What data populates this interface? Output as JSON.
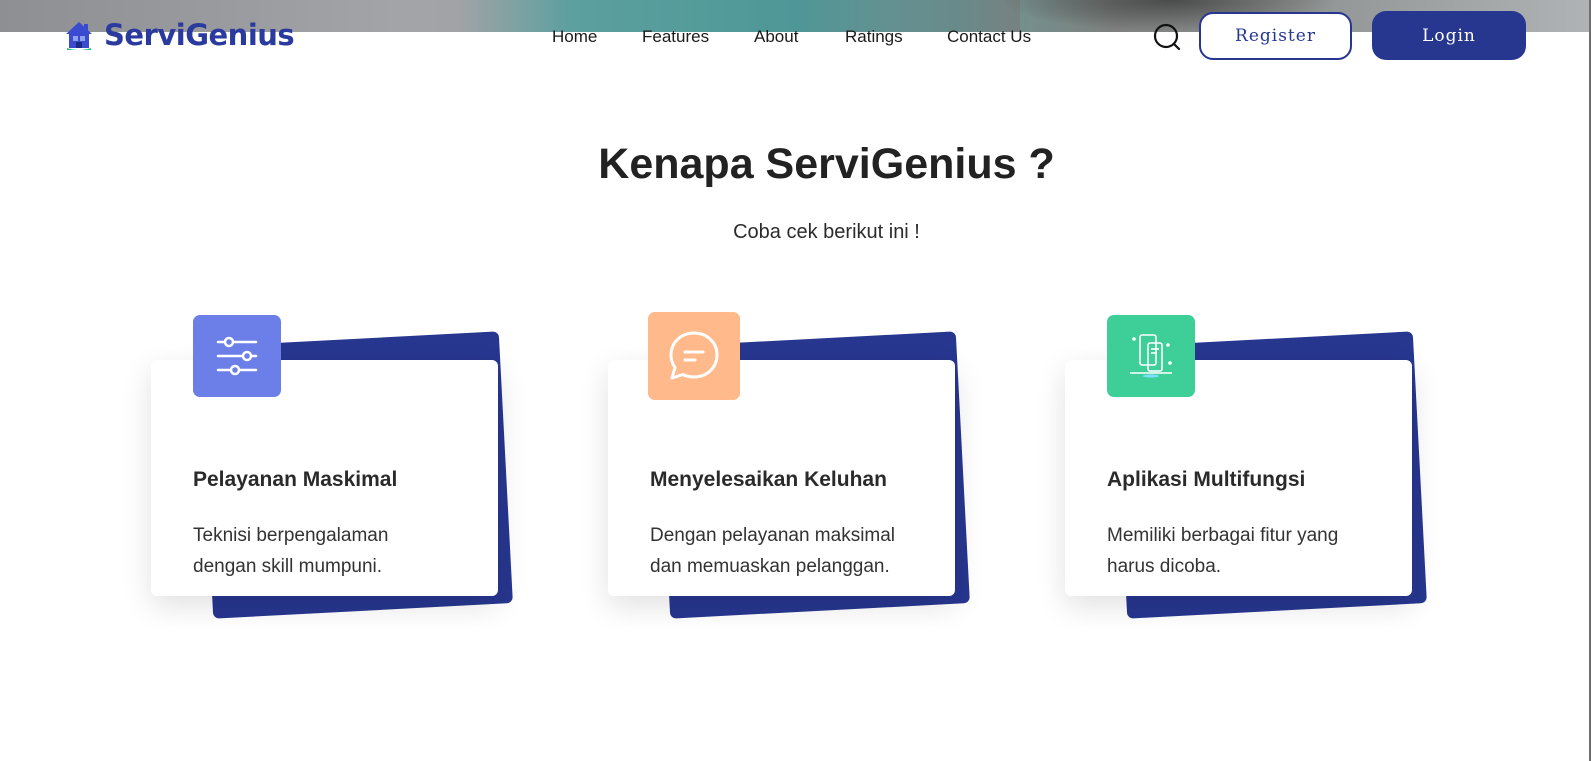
{
  "header": {
    "brand": "ServiGenius",
    "nav": [
      "Home",
      "Features",
      "About",
      "Ratings",
      "Contact Us"
    ],
    "register_label": "Register",
    "login_label": "Login"
  },
  "section": {
    "title": "Kenapa ServiGenius ?",
    "subtitle": "Coba cek berikut ini !"
  },
  "cards": [
    {
      "title": "Pelayanan Maskimal",
      "description": "Teknisi berpengalaman dengan skill mumpuni.",
      "icon": "sliders-icon",
      "icon_color": "#6c7fe8"
    },
    {
      "title": "Menyelesaikan Keluhan",
      "description": "Dengan pelayanan maksimal dan memuaskan pelanggan.",
      "icon": "chat-bubble-icon",
      "icon_color": "#ffb98a"
    },
    {
      "title": "Aplikasi Multifungsi",
      "description": "Memiliki berbagai fitur yang harus dicoba.",
      "icon": "devices-icon",
      "icon_color": "#3ecf98"
    }
  ],
  "colors": {
    "brand": "#27368f",
    "heading": "#222222"
  }
}
